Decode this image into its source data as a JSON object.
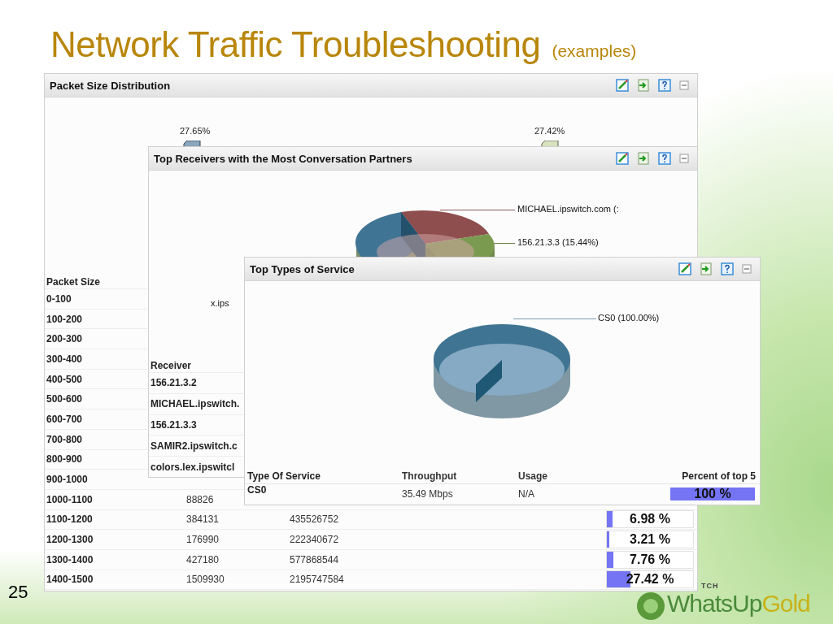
{
  "slide": {
    "title": "Network Traffic Troubleshooting",
    "subtitle": "(examples)",
    "number": "25"
  },
  "logo": {
    "tagline": "TCH",
    "word": "WhatsUp",
    "accent": "Gold"
  },
  "packet_size_panel": {
    "title": "Packet Size Distribution",
    "bar_labels": [
      "27.65%",
      "27.42%"
    ],
    "column_1": "Packet Size",
    "rows": [
      {
        "size": "0-100"
      },
      {
        "size": "100-200"
      },
      {
        "size": "200-300"
      },
      {
        "size": "300-400"
      },
      {
        "size": "400-500"
      },
      {
        "size": "500-600"
      },
      {
        "size": "600-700"
      },
      {
        "size": "700-800"
      },
      {
        "size": "800-900"
      },
      {
        "size": "900-1000"
      },
      {
        "size": "1000-1100",
        "packets": "88826"
      },
      {
        "size": "1100-1200",
        "packets": "384131",
        "bytes": "435526752",
        "percent": "6.98 %",
        "level": 0.0698
      },
      {
        "size": "1200-1300",
        "packets": "176990",
        "bytes": "222340672",
        "percent": "3.21 %",
        "level": 0.0321
      },
      {
        "size": "1300-1400",
        "packets": "427180",
        "bytes": "577868544",
        "percent": "7.76 %",
        "level": 0.0776
      },
      {
        "size": "1400-1500",
        "packets": "1509930",
        "bytes": "2195747584",
        "percent": "27.42 %",
        "level": 0.2742
      }
    ]
  },
  "receivers_panel": {
    "title": "Top Receivers with the Most Conversation Partners",
    "pie_labels": [
      "MICHAEL.ipswitch.com (:",
      "156.21.3.3 (15.44%)"
    ],
    "pie_label_left": "x.ips",
    "column_1": "Receiver",
    "rows": [
      "156.21.3.2",
      "MICHAEL.ipswitch.",
      "156.21.3.3",
      "SAMIR2.ipswitch.c",
      "colors.lex.ipswitcl"
    ]
  },
  "service_panel": {
    "title": "Top Types of Service",
    "pie_label": "CS0 (100.00%)",
    "columns": [
      "Type Of Service",
      "Throughput",
      "Usage",
      "Percent of top 5"
    ],
    "rows": [
      {
        "type": "CS0",
        "throughput": "35.49 Mbps",
        "usage": "N/A",
        "percent": "100 %",
        "level": 1
      }
    ]
  }
}
